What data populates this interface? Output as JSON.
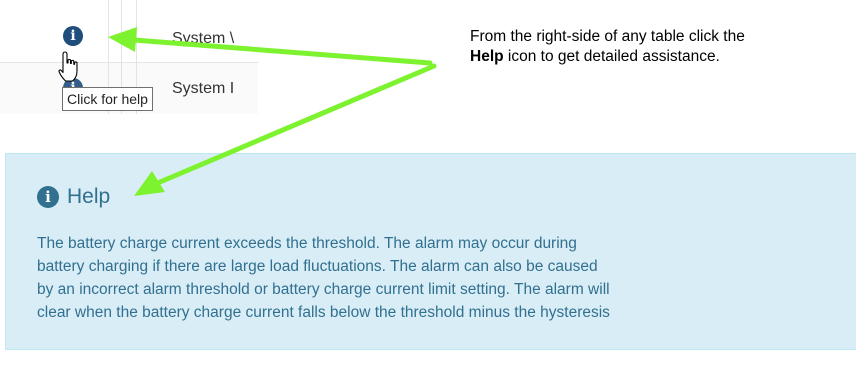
{
  "table": {
    "rows": [
      {
        "label": "System \\"
      },
      {
        "label": "System I"
      }
    ],
    "tooltip": "Click for help",
    "icon": "info-circle-icon"
  },
  "annotation": {
    "line1": "From  the right-side of any table click the",
    "bold_word": "Help",
    "line2_rest": " icon to get detailed assistance."
  },
  "help": {
    "icon": "info-circle-icon",
    "title": "Help",
    "lines": [
      "The battery charge current exceeds the threshold. The alarm may occur during",
      "battery charging if there are large load fluctuations. The alarm can also be caused",
      "by an incorrect alarm threshold or battery charge current limit setting. The alarm will",
      "clear when the battery charge current falls below the threshold minus the hysteresis"
    ]
  },
  "colors": {
    "arrow": "#7df22e",
    "panel_bg": "#d9edf7",
    "panel_text": "#31708f",
    "icon_dark": "#1f4e7d"
  }
}
